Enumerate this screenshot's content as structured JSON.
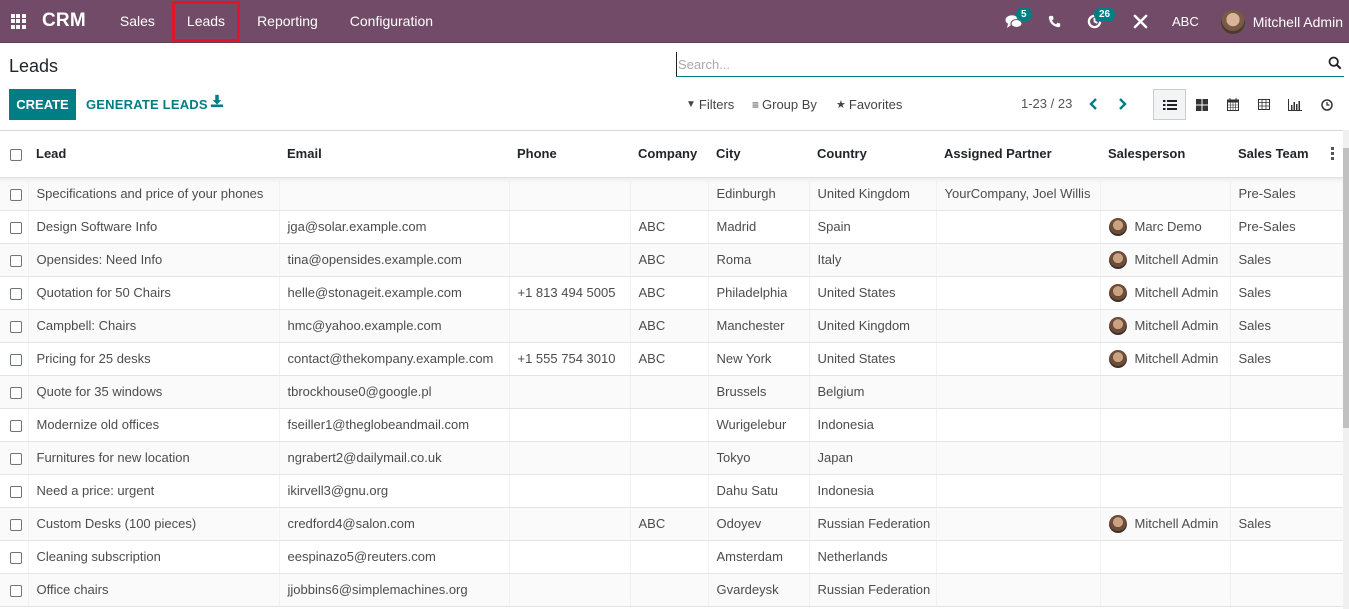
{
  "navbar": {
    "brand": "CRM",
    "menu": [
      {
        "label": "Sales"
      },
      {
        "label": "Leads"
      },
      {
        "label": "Reporting"
      },
      {
        "label": "Configuration"
      }
    ],
    "messages_count": "5",
    "activities_count": "26",
    "company": "ABC",
    "user_name": "Mitchell Admin",
    "icons": [
      "apps-icon",
      "chat-icon",
      "phone-icon",
      "activity-clock-icon",
      "tools-icon"
    ]
  },
  "control_panel": {
    "title": "Leads",
    "create_label": "CREATE",
    "generate_label": "GENERATE LEADS",
    "search_placeholder": "Search...",
    "search_value": "",
    "filters_label": "Filters",
    "groupby_label": "Group By",
    "favorites_label": "Favorites",
    "pager": "1-23 / 23",
    "views": [
      "list",
      "kanban",
      "calendar",
      "pivot",
      "graph",
      "activity"
    ],
    "active_view": "list"
  },
  "table": {
    "columns": [
      "Lead",
      "Email",
      "Phone",
      "Company",
      "City",
      "Country",
      "Assigned Partner",
      "Salesperson",
      "Sales Team"
    ],
    "rows": [
      {
        "lead": "Specifications and price of your phones",
        "email": "",
        "phone": "",
        "company": "",
        "city": "Edinburgh",
        "country": "United Kingdom",
        "partner": "YourCompany, Joel Willis",
        "salesperson": "",
        "team": "Pre-Sales"
      },
      {
        "lead": "Design Software Info",
        "email": "jga@solar.example.com",
        "phone": "",
        "company": "ABC",
        "city": "Madrid",
        "country": "Spain",
        "partner": "",
        "salesperson": "Marc Demo",
        "team": "Pre-Sales"
      },
      {
        "lead": "Opensides: Need Info",
        "email": "tina@opensides.example.com",
        "phone": "",
        "company": "ABC",
        "city": "Roma",
        "country": "Italy",
        "partner": "",
        "salesperson": "Mitchell Admin",
        "team": "Sales"
      },
      {
        "lead": "Quotation for 50 Chairs",
        "email": "helle@stonageit.example.com",
        "phone": "+1 813 494 5005",
        "company": "ABC",
        "city": "Philadelphia",
        "country": "United States",
        "partner": "",
        "salesperson": "Mitchell Admin",
        "team": "Sales"
      },
      {
        "lead": "Campbell: Chairs",
        "email": "hmc@yahoo.example.com",
        "phone": "",
        "company": "ABC",
        "city": "Manchester",
        "country": "United Kingdom",
        "partner": "",
        "salesperson": "Mitchell Admin",
        "team": "Sales"
      },
      {
        "lead": "Pricing for 25 desks",
        "email": "contact@thekompany.example.com",
        "phone": "+1 555 754 3010",
        "company": "ABC",
        "city": "New York",
        "country": "United States",
        "partner": "",
        "salesperson": "Mitchell Admin",
        "team": "Sales"
      },
      {
        "lead": "Quote for 35 windows",
        "email": "tbrockhouse0@google.pl",
        "phone": "",
        "company": "",
        "city": "Brussels",
        "country": "Belgium",
        "partner": "",
        "salesperson": "",
        "team": ""
      },
      {
        "lead": "Modernize old offices",
        "email": "fseiller1@theglobeandmail.com",
        "phone": "",
        "company": "",
        "city": "Wurigelebur",
        "country": "Indonesia",
        "partner": "",
        "salesperson": "",
        "team": ""
      },
      {
        "lead": "Furnitures for new location",
        "email": "ngrabert2@dailymail.co.uk",
        "phone": "",
        "company": "",
        "city": "Tokyo",
        "country": "Japan",
        "partner": "",
        "salesperson": "",
        "team": ""
      },
      {
        "lead": "Need a price: urgent",
        "email": "ikirvell3@gnu.org",
        "phone": "",
        "company": "",
        "city": "Dahu Satu",
        "country": "Indonesia",
        "partner": "",
        "salesperson": "",
        "team": ""
      },
      {
        "lead": "Custom Desks (100 pieces)",
        "email": "credford4@salon.com",
        "phone": "",
        "company": "ABC",
        "city": "Odoyev",
        "country": "Russian Federation",
        "partner": "",
        "salesperson": "Mitchell Admin",
        "team": "Sales"
      },
      {
        "lead": "Cleaning subscription",
        "email": "eespinazo5@reuters.com",
        "phone": "",
        "company": "",
        "city": "Amsterdam",
        "country": "Netherlands",
        "partner": "",
        "salesperson": "",
        "team": ""
      },
      {
        "lead": "Office chairs",
        "email": "jjobbins6@simplemachines.org",
        "phone": "",
        "company": "",
        "city": "Gvardeysk",
        "country": "Russian Federation",
        "partner": "",
        "salesperson": "",
        "team": ""
      }
    ]
  },
  "colors": {
    "navbar": "#714b67",
    "accent": "#017e84",
    "highlight_box": "#e0142a"
  }
}
